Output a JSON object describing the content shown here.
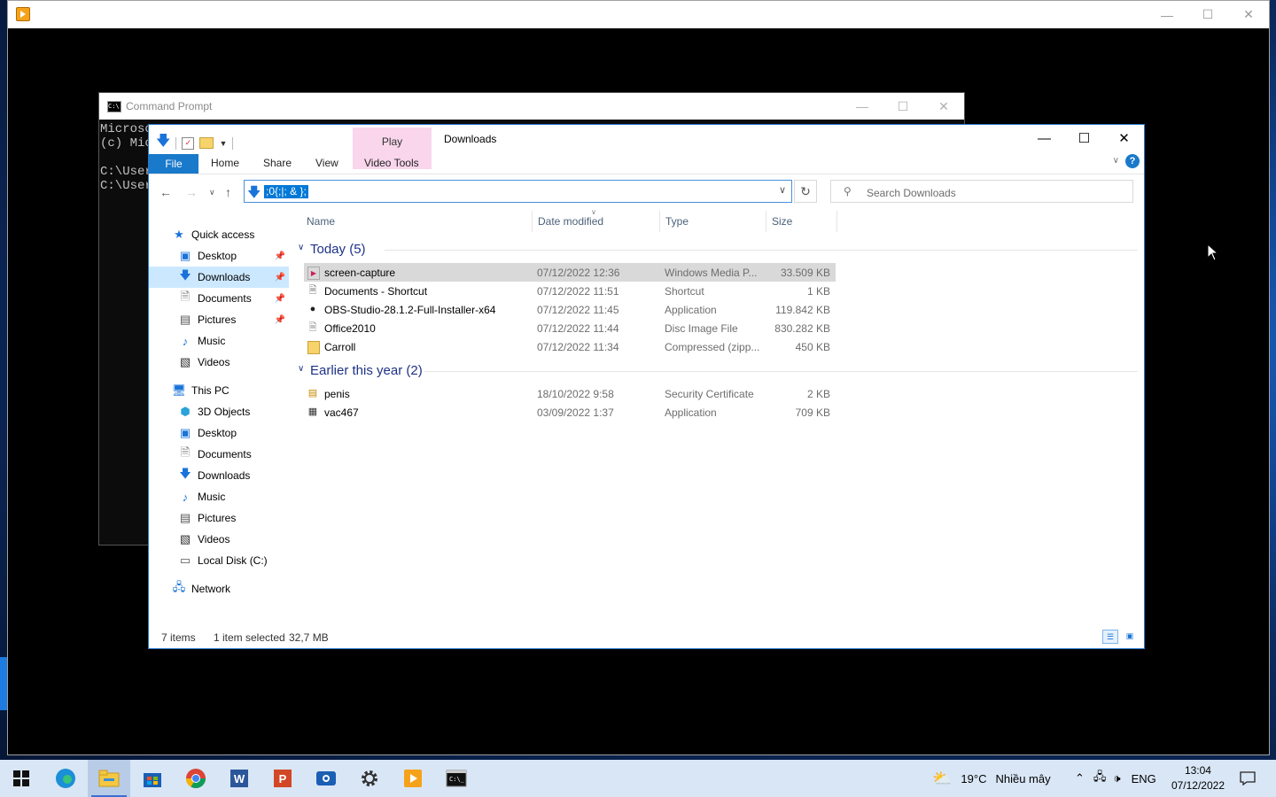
{
  "player": {
    "title": ""
  },
  "cmd": {
    "title": "Command Prompt",
    "lines": [
      "Microso",
      "(c) Mic",
      "",
      "C:\\User",
      "C:\\User"
    ]
  },
  "explorer": {
    "title": "Downloads",
    "context_tab_group": "Play",
    "ribbon_tabs": {
      "file": "File",
      "home": "Home",
      "share": "Share",
      "view": "View",
      "video_tools": "Video Tools"
    },
    "address_value": ";0{;|; & };",
    "search_placeholder": "Search Downloads",
    "nav": {
      "quick_access": "Quick access",
      "qa_items": [
        "Desktop",
        "Downloads",
        "Documents",
        "Pictures",
        "Music",
        "Videos"
      ],
      "this_pc": "This PC",
      "pc_items": [
        "3D Objects",
        "Desktop",
        "Documents",
        "Downloads",
        "Music",
        "Pictures",
        "Videos",
        "Local Disk (C:)"
      ],
      "network": "Network"
    },
    "columns": {
      "name": "Name",
      "date": "Date modified",
      "type": "Type",
      "size": "Size"
    },
    "groups": [
      {
        "label": "Today (5)",
        "files": [
          {
            "name": "screen-capture",
            "date": "07/12/2022 12:36",
            "type": "Windows Media P...",
            "size": "33.509 KB"
          },
          {
            "name": "Documents - Shortcut",
            "date": "07/12/2022 11:51",
            "type": "Shortcut",
            "size": "1 KB"
          },
          {
            "name": "OBS-Studio-28.1.2-Full-Installer-x64",
            "date": "07/12/2022 11:45",
            "type": "Application",
            "size": "119.842 KB"
          },
          {
            "name": "Office2010",
            "date": "07/12/2022 11:44",
            "type": "Disc Image File",
            "size": "830.282 KB"
          },
          {
            "name": "Carroll",
            "date": "07/12/2022 11:34",
            "type": "Compressed (zipp...",
            "size": "450 KB"
          }
        ]
      },
      {
        "label": "Earlier this year (2)",
        "files": [
          {
            "name": "penis",
            "date": "18/10/2022 9:58",
            "type": "Security Certificate",
            "size": "2 KB"
          },
          {
            "name": "vac467",
            "date": "03/09/2022 1:37",
            "type": "Application",
            "size": "709 KB"
          }
        ]
      }
    ],
    "status": {
      "items": "7 items",
      "selected": "1 item selected",
      "size": "32,7 MB"
    }
  },
  "taskbar": {
    "weather_temp": "19°C",
    "weather_desc": "Nhiều mây",
    "language": "ENG",
    "time": "13:04",
    "date": "07/12/2022"
  },
  "colors": {
    "accent": "#1979ca",
    "selection": "#cce8ff",
    "group_header": "#1e3287",
    "context_tab": "#f9d6ec"
  }
}
